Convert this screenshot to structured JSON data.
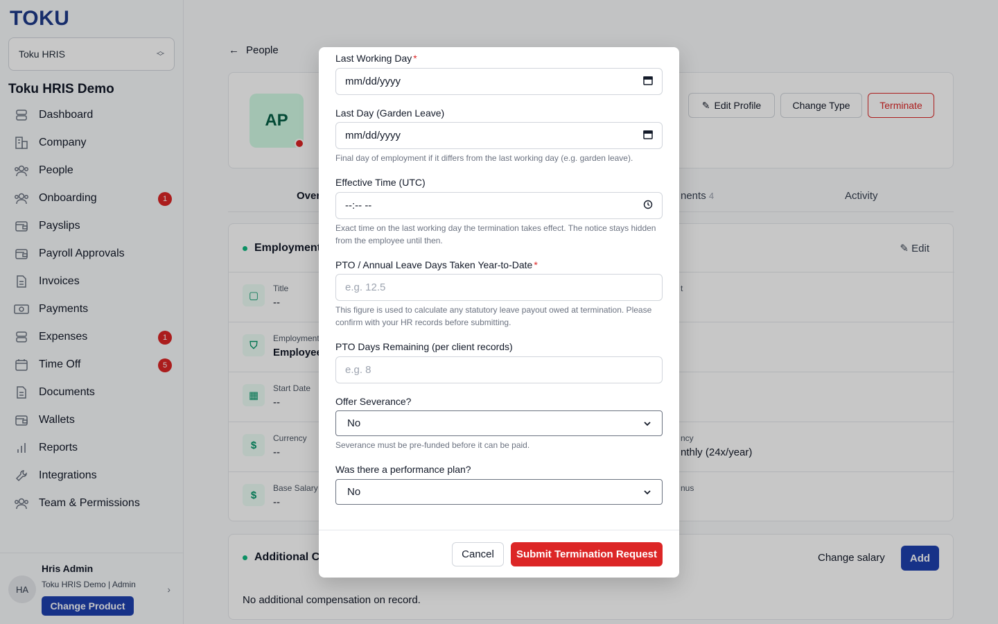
{
  "sidebar": {
    "logo": "TOKU",
    "product_select": "Toku HRIS",
    "org_name": "Toku HRIS Demo",
    "items": [
      {
        "label": "Dashboard",
        "icon": "stack-icon"
      },
      {
        "label": "Company",
        "icon": "building-icon"
      },
      {
        "label": "People",
        "icon": "people-icon"
      },
      {
        "label": "Onboarding",
        "icon": "people-icon",
        "badge": "1"
      },
      {
        "label": "Payslips",
        "icon": "wallet-icon"
      },
      {
        "label": "Payroll Approvals",
        "icon": "wallet-icon"
      },
      {
        "label": "Invoices",
        "icon": "document-icon"
      },
      {
        "label": "Payments",
        "icon": "banknote-icon"
      },
      {
        "label": "Expenses",
        "icon": "stack-icon",
        "badge": "1"
      },
      {
        "label": "Time Off",
        "icon": "calendar-icon",
        "badge": "5"
      },
      {
        "label": "Documents",
        "icon": "document-icon"
      },
      {
        "label": "Wallets",
        "icon": "wallet-icon"
      },
      {
        "label": "Reports",
        "icon": "bar-chart-icon"
      },
      {
        "label": "Integrations",
        "icon": "wrench-icon"
      },
      {
        "label": "Team & Permissions",
        "icon": "people-icon"
      }
    ],
    "user": {
      "initials": "HA",
      "name": "Hris Admin",
      "org": "Toku HRIS Demo | Admin",
      "change_product": "Change Product"
    }
  },
  "main": {
    "back_label": "People",
    "profile": {
      "initials": "AP",
      "edit_profile": "Edit Profile",
      "change_type": "Change Type",
      "terminate": "Terminate"
    },
    "tabs": {
      "overview": "Over",
      "documents": "nents",
      "documents_count": "4",
      "activity": "Activity"
    },
    "employment": {
      "title": "Employment",
      "edit": "Edit",
      "rows": [
        {
          "label": "Title",
          "value": "--",
          "right_label": "t",
          "right_value": ""
        },
        {
          "label": "Employment",
          "value": "Employee",
          "right_label": "",
          "right_value": ""
        },
        {
          "label": "Start Date",
          "value": "--",
          "right_label": "",
          "right_value": ""
        },
        {
          "label": "Currency",
          "value": "--",
          "right_label": "ncy",
          "right_value": "nthly (24x/year)"
        },
        {
          "label": "Base Salary",
          "value": "--",
          "right_label": "nus",
          "right_value": ""
        }
      ]
    },
    "additional": {
      "title": "Additional C",
      "change_salary": "Change salary",
      "add": "Add",
      "empty": "No additional compensation on record."
    }
  },
  "modal": {
    "last_working_day": {
      "label": "Last Working Day",
      "value": "mm/dd/yyyy"
    },
    "last_day_garden": {
      "label": "Last Day (Garden Leave)",
      "value": "mm/dd/yyyy",
      "help": "Final day of employment if it differs from the last working day (e.g. garden leave)."
    },
    "effective_time": {
      "label": "Effective Time (UTC)",
      "value": "--:-- --",
      "help": "Exact time on the last working day the termination takes effect. The notice stays hidden from the employee until then."
    },
    "pto_taken": {
      "label": "PTO / Annual Leave Days Taken Year-to-Date",
      "placeholder": "e.g. 12.5",
      "help": "This figure is used to calculate any statutory leave payout owed at termination. Please confirm with your HR records before submitting."
    },
    "pto_remaining": {
      "label": "PTO Days Remaining (per client records)",
      "placeholder": "e.g. 8"
    },
    "severance": {
      "label": "Offer Severance?",
      "value": "No",
      "help": "Severance must be pre-funded before it can be paid."
    },
    "performance_plan": {
      "label": "Was there a performance plan?",
      "value": "No"
    },
    "required_marker": "*",
    "cancel": "Cancel",
    "submit": "Submit Termination Request"
  }
}
